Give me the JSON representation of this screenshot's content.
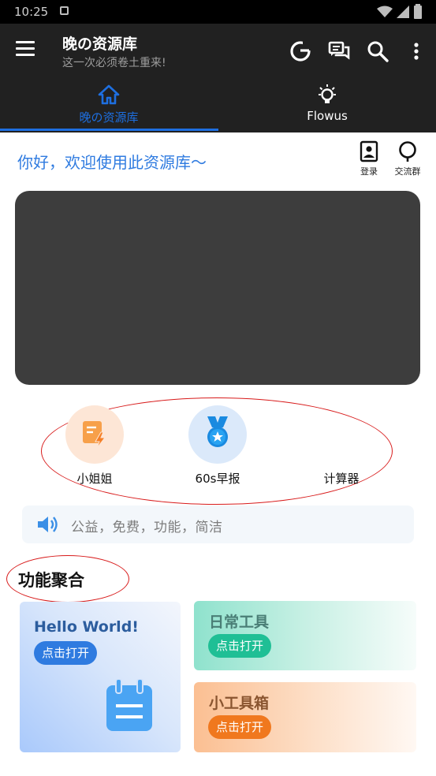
{
  "status_bar": {
    "time": "10:25"
  },
  "appbar": {
    "title": "晚の资源库",
    "subtitle": "这一次必须卷土重来!"
  },
  "tabs": [
    {
      "label": "晚の资源库",
      "active": true,
      "color": "#1e6fe0"
    },
    {
      "label": "Flowus",
      "active": false,
      "color": "#ffffff"
    }
  ],
  "greeting": "你好，欢迎使用此资源库〜",
  "actions": {
    "login_label": "登录",
    "group_label": "交流群"
  },
  "quick_items": [
    {
      "label": "小姐姐",
      "icon": "note-lightning-icon",
      "bg": "#fde6d6"
    },
    {
      "label": "60s早报",
      "icon": "medal-icon",
      "bg": "#dbe9fa"
    },
    {
      "label": "计算器",
      "icon": "",
      "bg": ""
    }
  ],
  "notice": {
    "text": "公益，免费，功能，简洁",
    "icon": "speaker-icon"
  },
  "section": {
    "title": "功能聚合"
  },
  "cards": {
    "hello": {
      "title": "Hello World!",
      "button": "点击打开",
      "accent": "#2f7be0",
      "icon": "notepad-icon"
    },
    "daily": {
      "title": "日常工具",
      "button": "点击打开",
      "accent": "#1fbf95"
    },
    "toolbox": {
      "title": "小工具箱",
      "button": "点击打开",
      "accent": "#f0781e"
    }
  }
}
